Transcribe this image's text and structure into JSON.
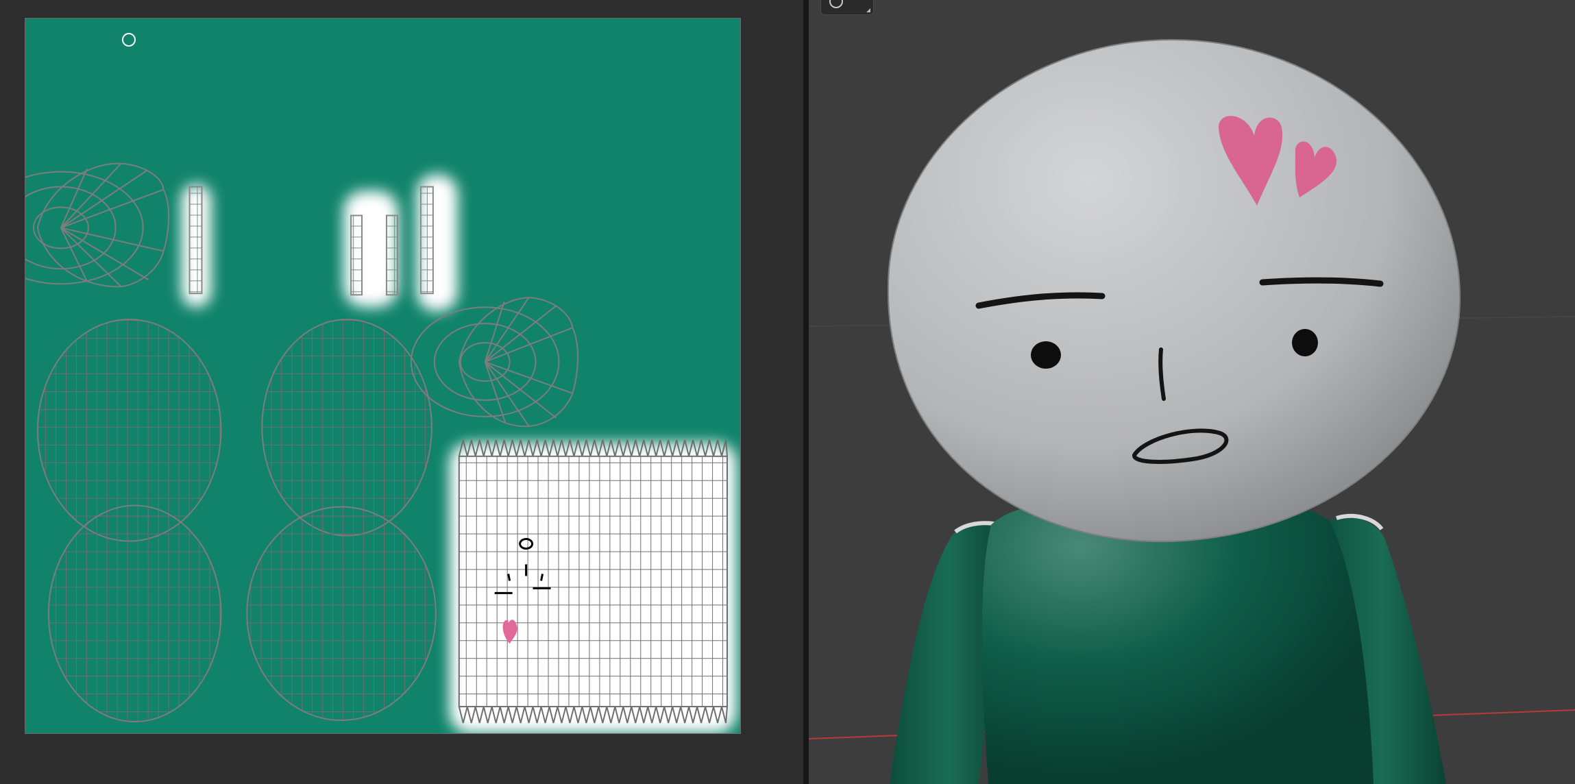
{
  "uv_editor": {
    "background_color": "#2d2d2d",
    "texture_color": "#10836a",
    "wire_color": "#7d7d7d",
    "paint_colors": [
      "#ffffff",
      "#000000",
      "#e0689a"
    ]
  },
  "viewport": {
    "background_color": "#3d3d3d",
    "body_color": "#0f5a46",
    "head_color": "#b9babc",
    "heart_color": "#d9668f",
    "x_axis_color": "#b83a3a",
    "y_axis_color": "#7fa52a"
  },
  "tools": {
    "brush_cursor": "brush-circle-cursor",
    "gizmo": "navigation-gizmo-toggle"
  }
}
